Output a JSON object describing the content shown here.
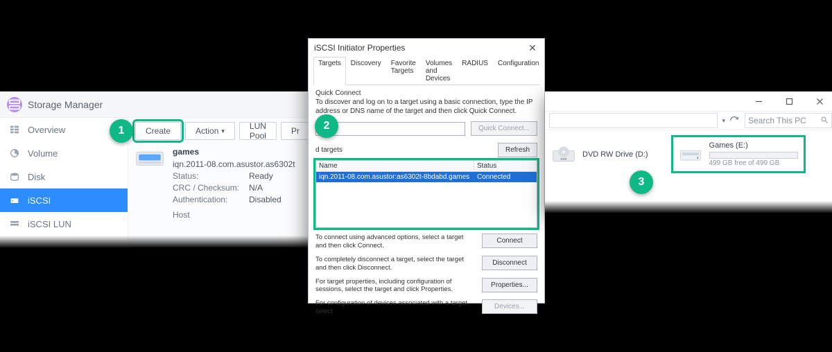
{
  "storage_manager": {
    "title": "Storage Manager",
    "sidebar": {
      "items": [
        {
          "label": "Overview"
        },
        {
          "label": "Volume"
        },
        {
          "label": "Disk"
        },
        {
          "label": "iSCSI"
        },
        {
          "label": "iSCSI LUN"
        }
      ]
    },
    "toolbar": {
      "create": "Create",
      "action": "Action",
      "lun_pool": "LUN Pool",
      "pr": "Pr"
    },
    "lun": {
      "name": "games",
      "iqn_line": "iqn.2011-08.com.asustor.as6302t",
      "rows": {
        "status_k": "Status:",
        "status_v": "Ready",
        "crc_k": "CRC / Checksum:",
        "crc_v": "N/A",
        "auth_k": "Authentication:",
        "auth_v": "Disabled"
      },
      "host_k": "Host"
    }
  },
  "iscsi": {
    "title": "iSCSI Initiator Properties",
    "tabs": [
      "Targets",
      "Discovery",
      "Favorite Targets",
      "Volumes and Devices",
      "RADIUS",
      "Configuration"
    ],
    "quick_connect": {
      "header": "Quick Connect",
      "desc": "To discover and log on to a target using a basic connection, type the IP address or DNS name of the target and then click Quick Connect.",
      "button": "Quick Connect..."
    },
    "discovered_header": "d targets",
    "refresh": "Refresh",
    "columns": {
      "name": "Name",
      "status": "Status"
    },
    "row": {
      "name": "iqn.2011-08.com.asustor:as6302t-8bdabd.games",
      "status": "Connected"
    },
    "help": {
      "p1": "To connect using advanced options, select a target and then click Connect.",
      "p2": "To completely disconnect a target, select the target and then click Disconnect.",
      "p3": "For target properties, including configuration of sessions, select the target and click Properties.",
      "p4": "For configuration of devices associated with a target, select"
    },
    "buttons": {
      "connect": "Connect",
      "disconnect": "Disconnect",
      "properties": "Properties...",
      "devices": "Devices..."
    }
  },
  "explorer": {
    "search_placeholder": "Search This PC",
    "drives": {
      "dvd": {
        "label": "DVD RW Drive (D:)"
      },
      "games": {
        "label": "Games (E:)",
        "sub": "499 GB free of 499 GB"
      }
    }
  },
  "steps": {
    "s1": "1",
    "s2": "2",
    "s3": "3"
  }
}
